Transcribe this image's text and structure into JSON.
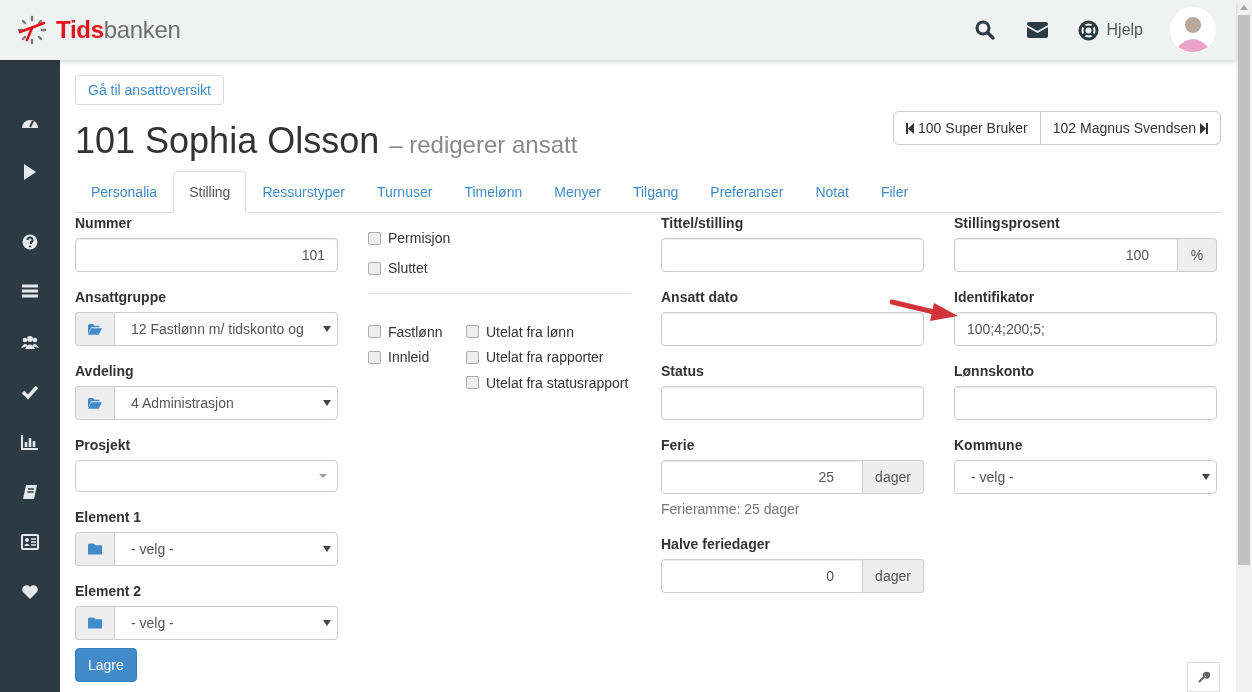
{
  "header": {
    "logo": {
      "part_1": "Tids",
      "part_2": "banken"
    },
    "help_label": "Hjelp"
  },
  "back_button": "Gå til ansattoversikt",
  "title": {
    "name": "101 Sophia Olsson",
    "subtitle": "– redigerer ansatt"
  },
  "pager": {
    "previous": "100 Super Bruker",
    "next": "102 Magnus Svendsen"
  },
  "tabs": [
    {
      "label": "Personalia",
      "selected": false
    },
    {
      "label": "Stilling",
      "selected": true
    },
    {
      "label": "Ressurstyper",
      "selected": false
    },
    {
      "label": "Turnuser",
      "selected": false
    },
    {
      "label": "Timelønn",
      "selected": false
    },
    {
      "label": "Menyer",
      "selected": false
    },
    {
      "label": "Tilgang",
      "selected": false
    },
    {
      "label": "Preferanser",
      "selected": false
    },
    {
      "label": "Notat",
      "selected": false
    },
    {
      "label": "Filer",
      "selected": false
    }
  ],
  "form": {
    "column_1": [
      {
        "kind": "text",
        "label": "Nummer",
        "value": "101",
        "numeric": true
      },
      {
        "kind": "open_folder_select",
        "label": "Ansattgruppe",
        "value": "12 Fastlønn m/ tidskonto og"
      },
      {
        "kind": "open_folder_select",
        "label": "Avdeling",
        "value": "4 Administrasjon"
      },
      {
        "kind": "search_select",
        "label": "Prosjekt"
      },
      {
        "kind": "folder_select",
        "label": "Element 1",
        "value": "- velg -"
      },
      {
        "kind": "folder_select",
        "label": "Element 2",
        "value": "- velg -"
      }
    ],
    "column_2": {
      "status_checks": [
        {
          "label": "Permisjon",
          "checked": false
        },
        {
          "label": "Sluttet",
          "checked": false
        }
      ],
      "type_checks": [
        {
          "label": "Fastlønn",
          "checked": false
        },
        {
          "label": "Innleid",
          "checked": false
        }
      ],
      "exclude_checks": [
        {
          "label": "Utelat fra lønn",
          "checked": false
        },
        {
          "label": "Utelat fra rapporter",
          "checked": false
        },
        {
          "label": "Utelat fra statusrapport",
          "checked": false
        }
      ]
    },
    "column_3": [
      {
        "kind": "text",
        "label": "Tittel/stilling"
      },
      {
        "kind": "text",
        "label": "Ansatt dato"
      },
      {
        "kind": "text",
        "label": "Status"
      },
      {
        "kind": "unit_text",
        "label": "Ferie",
        "value": "25",
        "unit": "dager",
        "help": "Ferieramme: 25 dager"
      },
      {
        "kind": "unit_text",
        "label": "Halve feriedager",
        "value": "0",
        "unit": "dager"
      }
    ],
    "column_4": [
      {
        "kind": "unit_text",
        "label": "Stillingsprosent",
        "value": "100",
        "unit": "%"
      },
      {
        "kind": "text",
        "label": "Identifikator",
        "value": "100;4;200;5;",
        "numeric": false
      },
      {
        "kind": "text",
        "label": "Lønnskonto"
      },
      {
        "kind": "select",
        "label": "Kommune",
        "value": "- velg -"
      }
    ]
  },
  "save_button": "Lagre"
}
